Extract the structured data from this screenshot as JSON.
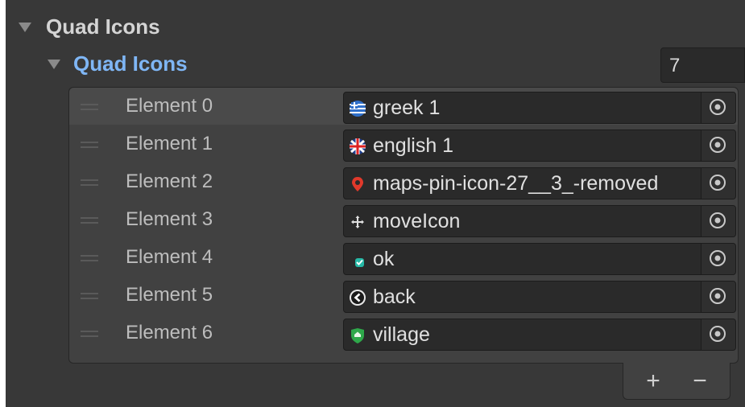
{
  "inspector": {
    "outer_foldout_label": "Quad Icons",
    "inner_foldout_label": "Quad Icons",
    "array_size": "7"
  },
  "elements": [
    {
      "label": "Element 0",
      "value": "greek 1",
      "icon": "greek-flag-icon"
    },
    {
      "label": "Element 1",
      "value": "english 1",
      "icon": "uk-flag-icon"
    },
    {
      "label": "Element 2",
      "value": "maps-pin-icon-27__3_-removed",
      "icon": "map-pin-icon"
    },
    {
      "label": "Element 3",
      "value": "moveIcon",
      "icon": "move-icon"
    },
    {
      "label": "Element 4",
      "value": "ok",
      "icon": "ok-icon"
    },
    {
      "label": "Element 5",
      "value": "back",
      "icon": "back-icon"
    },
    {
      "label": "Element 6",
      "value": "village",
      "icon": "village-shield-icon"
    }
  ],
  "footer": {
    "add_label": "+",
    "remove_label": "−"
  },
  "colors": {
    "panel_bg": "#383838",
    "list_bg": "#414141",
    "field_bg": "#2a2a2a",
    "foldout_accent": "#7fb6f5"
  }
}
